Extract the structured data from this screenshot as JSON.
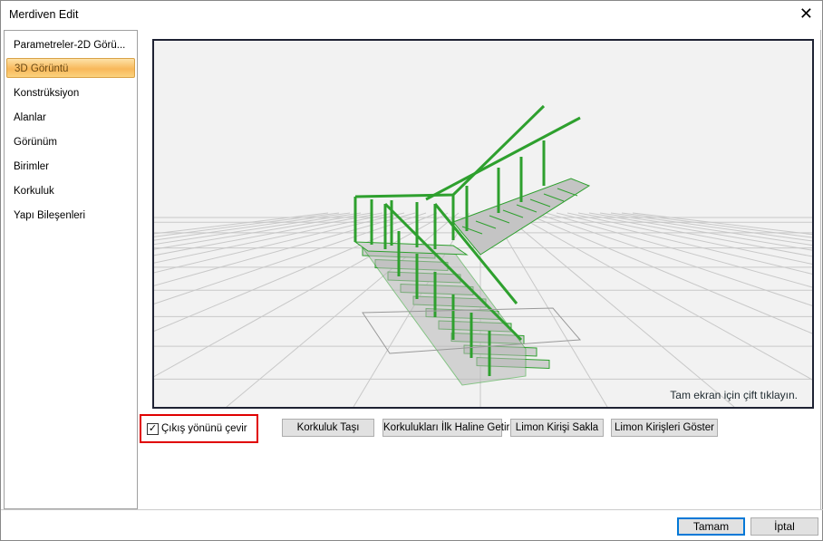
{
  "window": {
    "title": "Merdiven Edit"
  },
  "sidebar": {
    "items": [
      {
        "label": "Parametreler-2D Görü..."
      },
      {
        "label": "3D Görüntü",
        "selected": true
      },
      {
        "label": "Konstrüksiyon"
      },
      {
        "label": "Alanlar"
      },
      {
        "label": "Görünüm"
      },
      {
        "label": "Birimler"
      },
      {
        "label": "Korkuluk"
      },
      {
        "label": "Yapı Bileşenleri"
      }
    ]
  },
  "viewport": {
    "hint": "Tam ekran için çift tıklayın.",
    "rail_color": "#2ea02e",
    "grid_color": "#c8c8c8"
  },
  "options": {
    "flip_exit_label": "Çıkış yönünü çevir",
    "flip_exit_checked": true
  },
  "actions": {
    "move_railing": "Korkuluk Taşı",
    "reset_railings": "Korkulukları İlk Haline Getir",
    "hide_stringer": "Limon Kirişi Sakla",
    "show_stringers": "Limon Kirişleri Göster"
  },
  "footer": {
    "ok": "Tamam",
    "cancel": "İptal"
  }
}
